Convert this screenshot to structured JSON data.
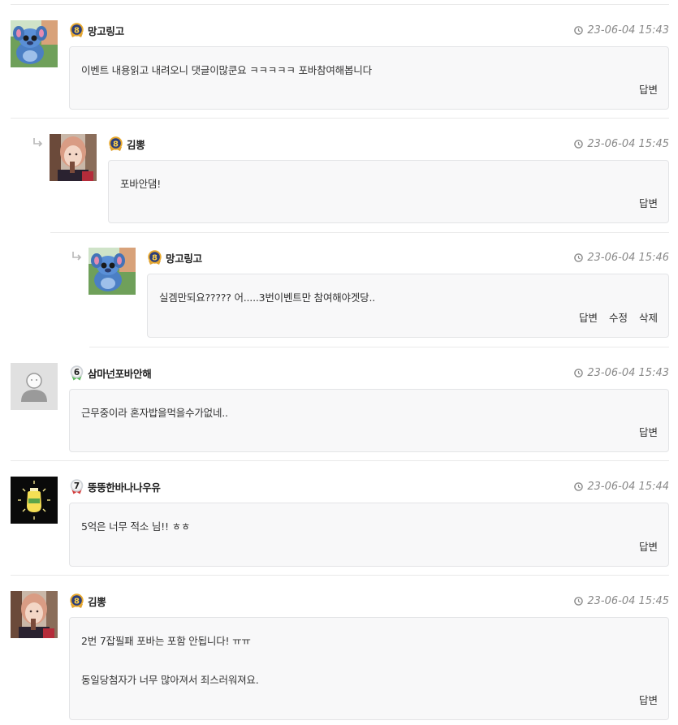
{
  "actions": {
    "reply": "답변",
    "edit": "수정",
    "delete": "삭제"
  },
  "comments": [
    {
      "nick": "망고링고",
      "level": "8",
      "time": "23-06-04 15:43",
      "lines": [
        "이벤트 내용읽고 내려오니 댓글이많쿤요 ㅋㅋㅋㅋㅋ 포바참여해봅니다"
      ],
      "avatar": "stitch"
    },
    {
      "nick": "김뽕",
      "level": "8",
      "time": "23-06-04 15:45",
      "lines": [
        "포바안댐!"
      ],
      "avatar": "girl"
    },
    {
      "nick": "망고링고",
      "level": "8",
      "time": "23-06-04 15:46",
      "lines": [
        "실겜만되요????? 어.....3번이벤트만 참여해야겟당.."
      ],
      "avatar": "stitch"
    },
    {
      "nick": "삼마넌포바안해",
      "level": "6",
      "time": "23-06-04 15:43",
      "lines": [
        "근무중이라 혼자밥을먹을수가없네.."
      ],
      "avatar": "default"
    },
    {
      "nick": "뚱뚱한바나나우유",
      "level": "7",
      "time": "23-06-04 15:44",
      "lines": [
        "5억은 너무 적소 님!! ㅎㅎ"
      ],
      "avatar": "milk"
    },
    {
      "nick": "김뽕",
      "level": "8",
      "time": "23-06-04 15:45",
      "lines": [
        "2번 7잡필패 포바는 포함 안됩니다! ㅠㅠ",
        "동일당첨자가 너무 많아져서 죄스러워져요."
      ],
      "avatar": "girl"
    }
  ],
  "colors": {
    "bubble_bg": "#f8f8f9",
    "bubble_border": "#e3e4e6",
    "time": "#8a8a8a",
    "badge_gold": "#e9a92c",
    "badge_navy": "#2c3e7a"
  }
}
